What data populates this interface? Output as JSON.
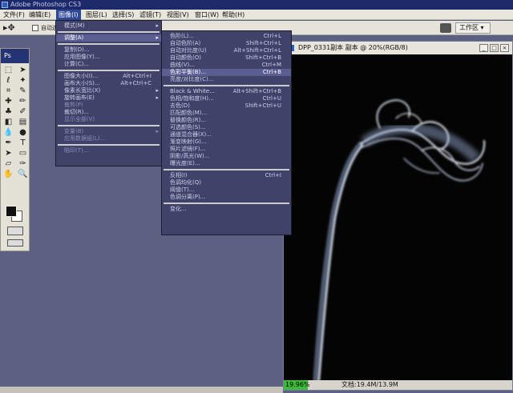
{
  "app": {
    "title": "Adobe Photoshop CS3",
    "logo": "Ps"
  },
  "menubar": [
    "文件(F)",
    "编辑(E)",
    "图像(I)",
    "图层(L)",
    "选择(S)",
    "滤镜(T)",
    "视图(V)",
    "窗口(W)",
    "帮助(H)"
  ],
  "active_menu": "图像(I)",
  "options": {
    "tool_icon": "move-tool-icon",
    "checkbox_label": "自动选",
    "workspace_label": "工作区 ▾"
  },
  "image_menu": [
    {
      "label": "模式(M)",
      "submenu": true
    },
    {
      "sep": true
    },
    {
      "label": "调整(A)",
      "submenu": true,
      "highlight": true
    },
    {
      "sep": true
    },
    {
      "label": "复制(D)..."
    },
    {
      "label": "应用图像(Y)..."
    },
    {
      "label": "计算(C)..."
    },
    {
      "sep": true
    },
    {
      "label": "图像大小(I)...",
      "shortcut": "Alt+Ctrl+I"
    },
    {
      "label": "画布大小(S)...",
      "shortcut": "Alt+Ctrl+C"
    },
    {
      "label": "像素长宽比(X)",
      "submenu": true
    },
    {
      "label": "旋转画布(E)",
      "submenu": true
    },
    {
      "label": "裁剪(P)",
      "disabled": true
    },
    {
      "label": "裁切(R)..."
    },
    {
      "label": "显示全部(V)",
      "disabled": true
    },
    {
      "sep": true
    },
    {
      "label": "变量(B)",
      "submenu": true,
      "disabled": true
    },
    {
      "label": "应用数据组(L)...",
      "disabled": true
    },
    {
      "sep": true
    },
    {
      "label": "陷印(T)...",
      "disabled": true
    }
  ],
  "adjust_menu": [
    {
      "label": "色阶(L)...",
      "shortcut": "Ctrl+L"
    },
    {
      "label": "自动色阶(A)",
      "shortcut": "Shift+Ctrl+L"
    },
    {
      "label": "自动对比度(U)",
      "shortcut": "Alt+Shift+Ctrl+L"
    },
    {
      "label": "自动颜色(O)",
      "shortcut": "Shift+Ctrl+B"
    },
    {
      "label": "曲线(V)...",
      "shortcut": "Ctrl+M"
    },
    {
      "label": "色彩平衡(B)...",
      "shortcut": "Ctrl+B",
      "highlight": true
    },
    {
      "label": "亮度/对比度(C)..."
    },
    {
      "sep": true
    },
    {
      "label": "Black & White...",
      "shortcut": "Alt+Shift+Ctrl+B"
    },
    {
      "label": "色相/饱和度(H)...",
      "shortcut": "Ctrl+U"
    },
    {
      "label": "去色(D)",
      "shortcut": "Shift+Ctrl+U"
    },
    {
      "label": "匹配颜色(M)..."
    },
    {
      "label": "替换颜色(R)..."
    },
    {
      "label": "可选颜色(S)..."
    },
    {
      "label": "通道混合器(X)..."
    },
    {
      "label": "渐变映射(G)..."
    },
    {
      "label": "照片滤镜(F)..."
    },
    {
      "label": "阴影/高光(W)..."
    },
    {
      "label": "曝光度(E)..."
    },
    {
      "sep": true
    },
    {
      "label": "反相(I)",
      "shortcut": "Ctrl+I"
    },
    {
      "label": "色调均化(Q)"
    },
    {
      "label": "阈值(T)..."
    },
    {
      "label": "色调分离(P)..."
    },
    {
      "sep": true
    },
    {
      "label": "变化..."
    }
  ],
  "document": {
    "title": "DPP_0331副本 副本 @ 20%(RGB/8)",
    "zoom": "19.96%",
    "info": "文档:19.4M/13.9M"
  },
  "colors": {
    "menu_bg": "#40426a",
    "highlight": "#5a5e92",
    "title_bar": "#1c2a6c",
    "zoom_green": "#3cbc36"
  }
}
